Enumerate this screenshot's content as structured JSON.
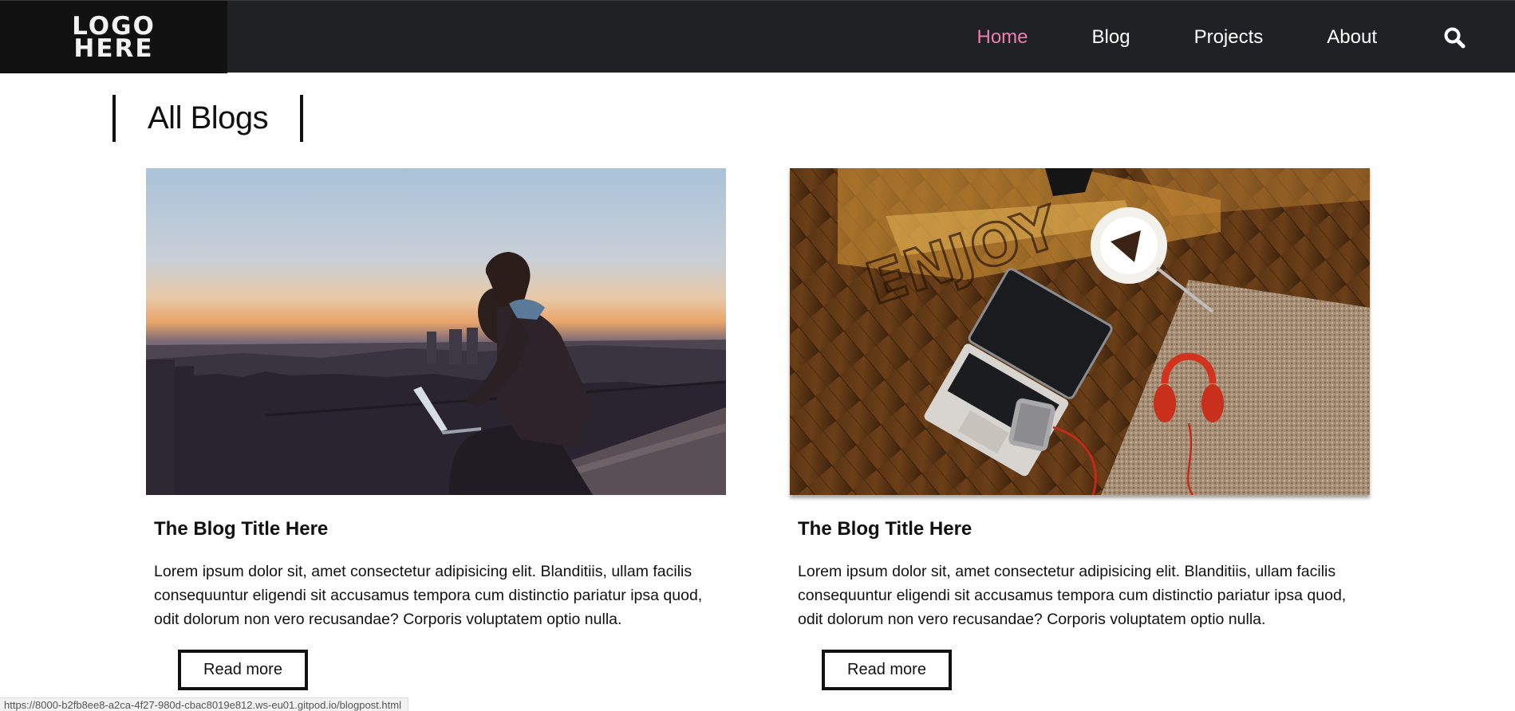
{
  "header": {
    "logo_line1": "LOGO",
    "logo_line2": "HERE",
    "nav": [
      {
        "label": "Home"
      },
      {
        "label": "Blog"
      },
      {
        "label": "Projects"
      },
      {
        "label": "About"
      }
    ],
    "active_nav": "Home",
    "accent_color": "#ef7fb0"
  },
  "page": {
    "section_title": "All Blogs"
  },
  "blogs": [
    {
      "image": "person-with-laptop-at-dusk",
      "title": "The Blog Title Here",
      "body": "Lorem ipsum dolor sit, amet consectetur adipisicing elit. Blanditiis, ullam facilis consequuntur eligendi sit accusamus tempora cum distinctio pariatur ipsa quod, odit dolorum non vero recusandae? Corporis voluptatem optio nulla.",
      "button_label": "Read more"
    },
    {
      "image": "laptop-coffee-headphones-on-wood-floor",
      "title": "The Blog Title Here",
      "body": "Lorem ipsum dolor sit, amet consectetur adipisicing elit. Blanditiis, ullam facilis consequuntur eligendi sit accusamus tempora cum distinctio pariatur ipsa quod, odit dolorum non vero recusandae? Corporis voluptatem optio nulla.",
      "button_label": "Read more"
    }
  ],
  "status_bar": {
    "url": "https://8000-b2fb8ee8-a2ca-4f27-980d-cbac8019e812.ws-eu01.gitpod.io/blogpost.html"
  }
}
